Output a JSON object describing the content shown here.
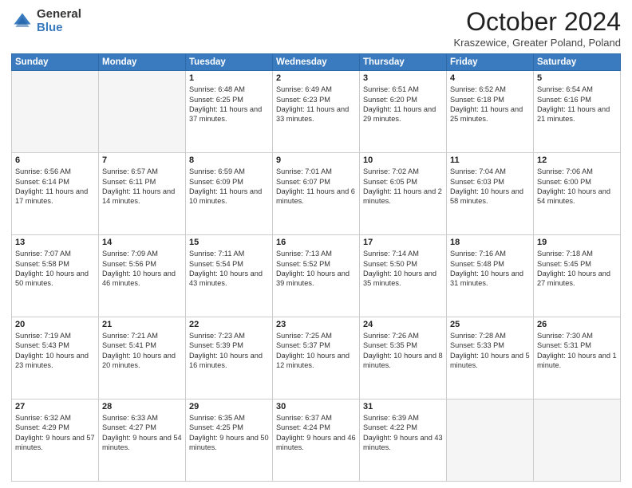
{
  "header": {
    "logo_general": "General",
    "logo_blue": "Blue",
    "month_title": "October 2024",
    "subtitle": "Kraszewice, Greater Poland, Poland"
  },
  "days_of_week": [
    "Sunday",
    "Monday",
    "Tuesday",
    "Wednesday",
    "Thursday",
    "Friday",
    "Saturday"
  ],
  "weeks": [
    [
      {
        "day": "",
        "content": ""
      },
      {
        "day": "",
        "content": ""
      },
      {
        "day": "1",
        "content": "Sunrise: 6:48 AM\nSunset: 6:25 PM\nDaylight: 11 hours and 37 minutes."
      },
      {
        "day": "2",
        "content": "Sunrise: 6:49 AM\nSunset: 6:23 PM\nDaylight: 11 hours and 33 minutes."
      },
      {
        "day": "3",
        "content": "Sunrise: 6:51 AM\nSunset: 6:20 PM\nDaylight: 11 hours and 29 minutes."
      },
      {
        "day": "4",
        "content": "Sunrise: 6:52 AM\nSunset: 6:18 PM\nDaylight: 11 hours and 25 minutes."
      },
      {
        "day": "5",
        "content": "Sunrise: 6:54 AM\nSunset: 6:16 PM\nDaylight: 11 hours and 21 minutes."
      }
    ],
    [
      {
        "day": "6",
        "content": "Sunrise: 6:56 AM\nSunset: 6:14 PM\nDaylight: 11 hours and 17 minutes."
      },
      {
        "day": "7",
        "content": "Sunrise: 6:57 AM\nSunset: 6:11 PM\nDaylight: 11 hours and 14 minutes."
      },
      {
        "day": "8",
        "content": "Sunrise: 6:59 AM\nSunset: 6:09 PM\nDaylight: 11 hours and 10 minutes."
      },
      {
        "day": "9",
        "content": "Sunrise: 7:01 AM\nSunset: 6:07 PM\nDaylight: 11 hours and 6 minutes."
      },
      {
        "day": "10",
        "content": "Sunrise: 7:02 AM\nSunset: 6:05 PM\nDaylight: 11 hours and 2 minutes."
      },
      {
        "day": "11",
        "content": "Sunrise: 7:04 AM\nSunset: 6:03 PM\nDaylight: 10 hours and 58 minutes."
      },
      {
        "day": "12",
        "content": "Sunrise: 7:06 AM\nSunset: 6:00 PM\nDaylight: 10 hours and 54 minutes."
      }
    ],
    [
      {
        "day": "13",
        "content": "Sunrise: 7:07 AM\nSunset: 5:58 PM\nDaylight: 10 hours and 50 minutes."
      },
      {
        "day": "14",
        "content": "Sunrise: 7:09 AM\nSunset: 5:56 PM\nDaylight: 10 hours and 46 minutes."
      },
      {
        "day": "15",
        "content": "Sunrise: 7:11 AM\nSunset: 5:54 PM\nDaylight: 10 hours and 43 minutes."
      },
      {
        "day": "16",
        "content": "Sunrise: 7:13 AM\nSunset: 5:52 PM\nDaylight: 10 hours and 39 minutes."
      },
      {
        "day": "17",
        "content": "Sunrise: 7:14 AM\nSunset: 5:50 PM\nDaylight: 10 hours and 35 minutes."
      },
      {
        "day": "18",
        "content": "Sunrise: 7:16 AM\nSunset: 5:48 PM\nDaylight: 10 hours and 31 minutes."
      },
      {
        "day": "19",
        "content": "Sunrise: 7:18 AM\nSunset: 5:45 PM\nDaylight: 10 hours and 27 minutes."
      }
    ],
    [
      {
        "day": "20",
        "content": "Sunrise: 7:19 AM\nSunset: 5:43 PM\nDaylight: 10 hours and 23 minutes."
      },
      {
        "day": "21",
        "content": "Sunrise: 7:21 AM\nSunset: 5:41 PM\nDaylight: 10 hours and 20 minutes."
      },
      {
        "day": "22",
        "content": "Sunrise: 7:23 AM\nSunset: 5:39 PM\nDaylight: 10 hours and 16 minutes."
      },
      {
        "day": "23",
        "content": "Sunrise: 7:25 AM\nSunset: 5:37 PM\nDaylight: 10 hours and 12 minutes."
      },
      {
        "day": "24",
        "content": "Sunrise: 7:26 AM\nSunset: 5:35 PM\nDaylight: 10 hours and 8 minutes."
      },
      {
        "day": "25",
        "content": "Sunrise: 7:28 AM\nSunset: 5:33 PM\nDaylight: 10 hours and 5 minutes."
      },
      {
        "day": "26",
        "content": "Sunrise: 7:30 AM\nSunset: 5:31 PM\nDaylight: 10 hours and 1 minute."
      }
    ],
    [
      {
        "day": "27",
        "content": "Sunrise: 6:32 AM\nSunset: 4:29 PM\nDaylight: 9 hours and 57 minutes."
      },
      {
        "day": "28",
        "content": "Sunrise: 6:33 AM\nSunset: 4:27 PM\nDaylight: 9 hours and 54 minutes."
      },
      {
        "day": "29",
        "content": "Sunrise: 6:35 AM\nSunset: 4:25 PM\nDaylight: 9 hours and 50 minutes."
      },
      {
        "day": "30",
        "content": "Sunrise: 6:37 AM\nSunset: 4:24 PM\nDaylight: 9 hours and 46 minutes."
      },
      {
        "day": "31",
        "content": "Sunrise: 6:39 AM\nSunset: 4:22 PM\nDaylight: 9 hours and 43 minutes."
      },
      {
        "day": "",
        "content": ""
      },
      {
        "day": "",
        "content": ""
      }
    ]
  ]
}
